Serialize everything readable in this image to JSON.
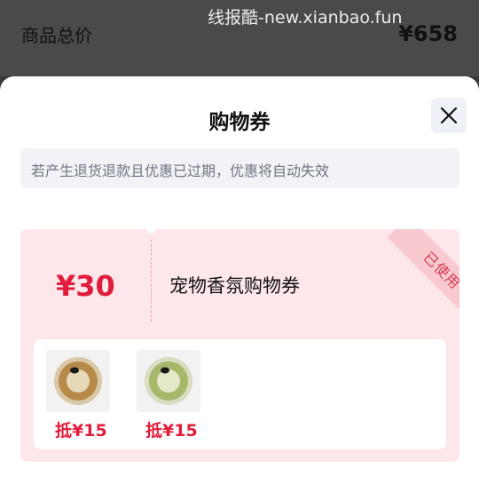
{
  "watermark": "线报酷-new.xianbao.fun",
  "order": {
    "total_label": "商品总价",
    "total_value": "¥658"
  },
  "sheet": {
    "title": "购物券",
    "close_icon": "close-icon",
    "notice": "若产生退货退款且优惠已过期，优惠将自动失效"
  },
  "coupon": {
    "amount": "¥30",
    "name": "宠物香氛购物券",
    "status": "已使用",
    "products": [
      {
        "price": "抵¥15",
        "icon": "cat-food-can-icon",
        "color": "#b88a4a"
      },
      {
        "price": "抵¥15",
        "icon": "cat-food-can-icon",
        "color": "#a6b86a"
      }
    ]
  },
  "colors": {
    "accent": "#e11d3b",
    "coupon_bg": "#fde7ea",
    "notice_bg": "#f1f3f7"
  }
}
